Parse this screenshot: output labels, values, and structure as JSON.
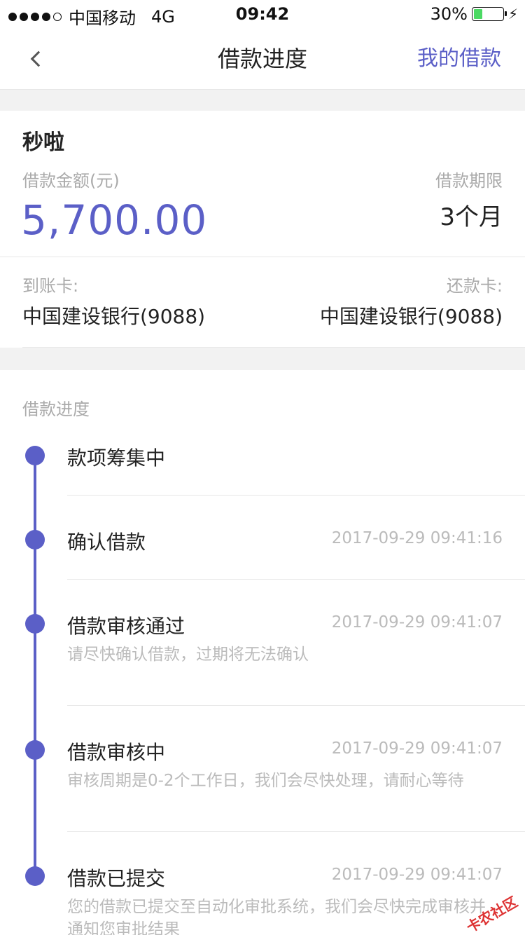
{
  "status_bar": {
    "carrier": "中国移动",
    "network": "4G",
    "time": "09:42",
    "battery_text": "30%",
    "battery_level": 0.3
  },
  "nav": {
    "title": "借款进度",
    "right_link": "我的借款",
    "accent_color": "#5b5fc7"
  },
  "loan": {
    "platform": "秒啦",
    "amount_label": "借款金额(元)",
    "amount": "5,700.00",
    "term_label": "借款期限",
    "term": "3个月",
    "receive_card_label": "到账卡:",
    "receive_card": "中国建设银行(9088)",
    "repay_card_label": "还款卡:",
    "repay_card": "中国建设银行(9088)"
  },
  "progress": {
    "section_title": "借款进度",
    "steps": [
      {
        "title": "款项筹集中",
        "time": "",
        "desc": ""
      },
      {
        "title": "确认借款",
        "time": "2017-09-29 09:41:16",
        "desc": ""
      },
      {
        "title": "借款审核通过",
        "time": "2017-09-29 09:41:07",
        "desc": "请尽快确认借款，过期将无法确认"
      },
      {
        "title": "借款审核中",
        "time": "2017-09-29 09:41:07",
        "desc": "审核周期是0-2个工作日，我们会尽快处理，请耐心等待"
      },
      {
        "title": "借款已提交",
        "time": "2017-09-29 09:41:07",
        "desc": "您的借款已提交至自动化审批系统，我们会尽快完成审核并通知您审批结果"
      }
    ]
  },
  "watermark": "卡农社区"
}
